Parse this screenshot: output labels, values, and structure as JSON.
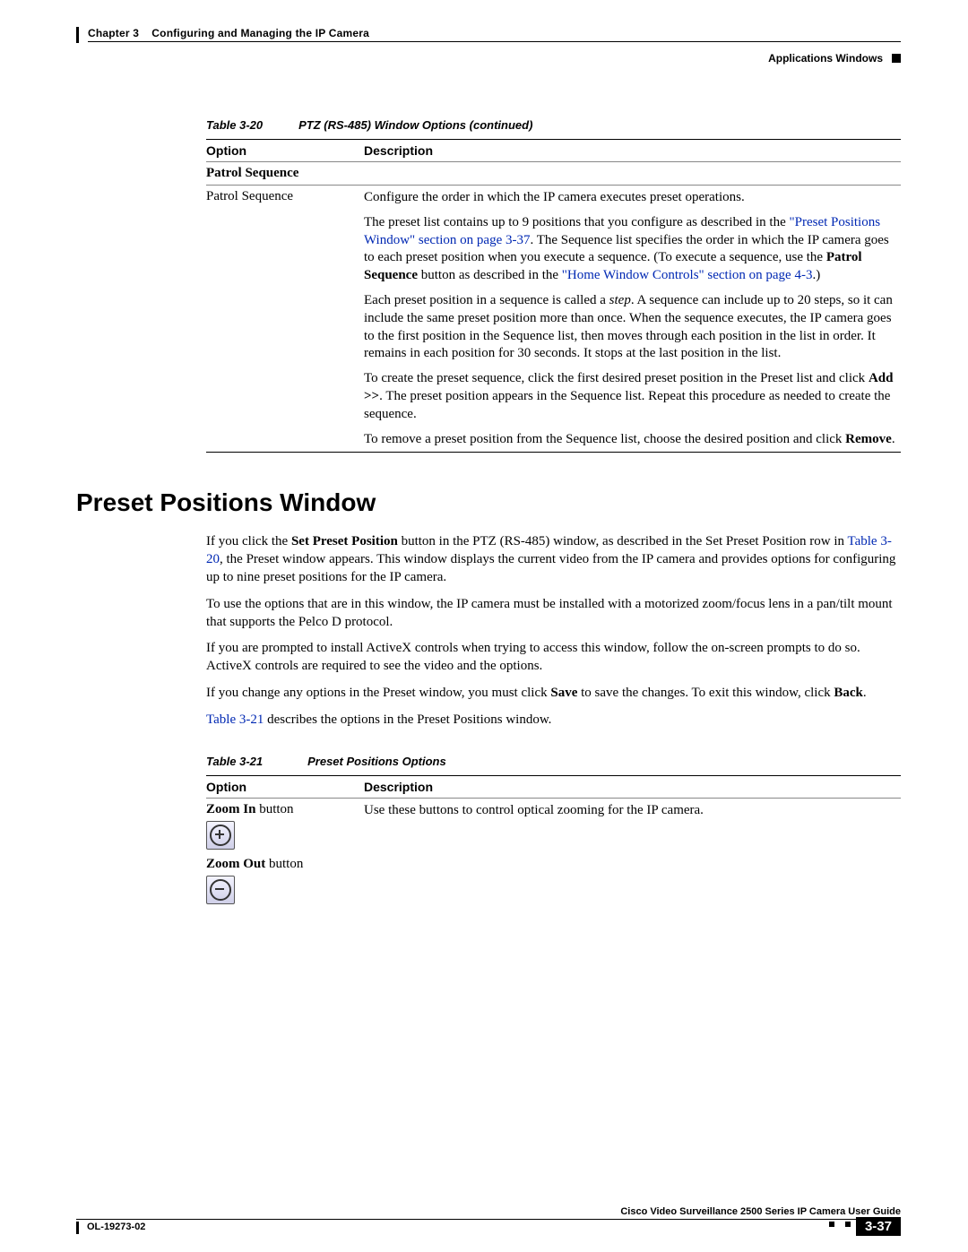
{
  "header": {
    "chapter_label": "Chapter 3",
    "chapter_title": "Configuring and Managing the IP Camera",
    "section_label": "Applications Windows"
  },
  "table20": {
    "caption_num": "Table 3-20",
    "caption_title": "PTZ (RS-485) Window Options (continued)",
    "col_option": "Option",
    "col_description": "Description",
    "sub_header": "Patrol Sequence",
    "row_label": "Patrol Sequence",
    "p1": "Configure the order in which the IP camera executes preset operations.",
    "p2a": "The preset list contains up to 9 positions that you configure as described in the ",
    "p2_link": "\"Preset Positions Window\" section on page 3-37",
    "p2b": ". The Sequence list specifies the order in which the IP camera goes to each preset position when you execute a sequence. (To execute a sequence, use the ",
    "p2_bold": "Patrol Sequence",
    "p2c": " button as described in the ",
    "p2_link2": "\"Home Window Controls\" section on page 4-3",
    "p2d": ".)",
    "p3a": "Each preset position in a sequence is called a ",
    "p3_em": "step",
    "p3b": ". A sequence can include up to 20 steps, so it can include the same preset position more than once. When the sequence executes, the IP camera goes to the first position in the Sequence list, then moves through each position in the list in order. It remains in each position for 30 seconds. It stops at the last position in the list.",
    "p4a": "To create the preset sequence, click the first desired preset position in the Preset list and click ",
    "p4_bold": "Add >>",
    "p4b": ". The preset position appears in the Sequence list. Repeat this procedure as needed to create the sequence.",
    "p5a": "To remove a preset position from the Sequence list, choose the desired position and click ",
    "p5_bold": "Remove",
    "p5b": "."
  },
  "section_title": "Preset Positions Window",
  "body": {
    "b1a": "If you click the ",
    "b1_bold": "Set Preset Position",
    "b1b": " button in the PTZ (RS-485) window, as described in the Set Preset Position row in ",
    "b1_link": "Table 3-20",
    "b1c": ", the Preset window appears. This window displays the current video from the IP camera and provides options for configuring up to nine preset positions for the IP camera.",
    "b2": "To use the options that are in this window, the IP camera must be installed with a motorized zoom/focus lens in a pan/tilt mount that supports the Pelco D protocol.",
    "b3": "If you are prompted to install ActiveX controls when trying to access this window, follow the on-screen prompts to do so. ActiveX controls are required to see the video and the options.",
    "b4a": "If you change any options in the Preset window, you must click ",
    "b4_bold1": "Save",
    "b4b": " to save the changes. To exit this window, click ",
    "b4_bold2": "Back",
    "b4c": ".",
    "b5_link": "Table 3-21",
    "b5b": " describes the options in the Preset Positions window."
  },
  "table21": {
    "caption_num": "Table 3-21",
    "caption_title": "Preset Positions Options",
    "col_option": "Option",
    "col_description": "Description",
    "row1_label_bold": "Zoom In",
    "row1_label_rest": " button",
    "row1_desc": "Use these buttons to control optical zooming for the IP camera.",
    "row2_label_bold": "Zoom Out",
    "row2_label_rest": " button"
  },
  "footer": {
    "guide": "Cisco Video Surveillance 2500 Series IP Camera User Guide",
    "doc_id": "OL-19273-02",
    "page": "3-37"
  }
}
